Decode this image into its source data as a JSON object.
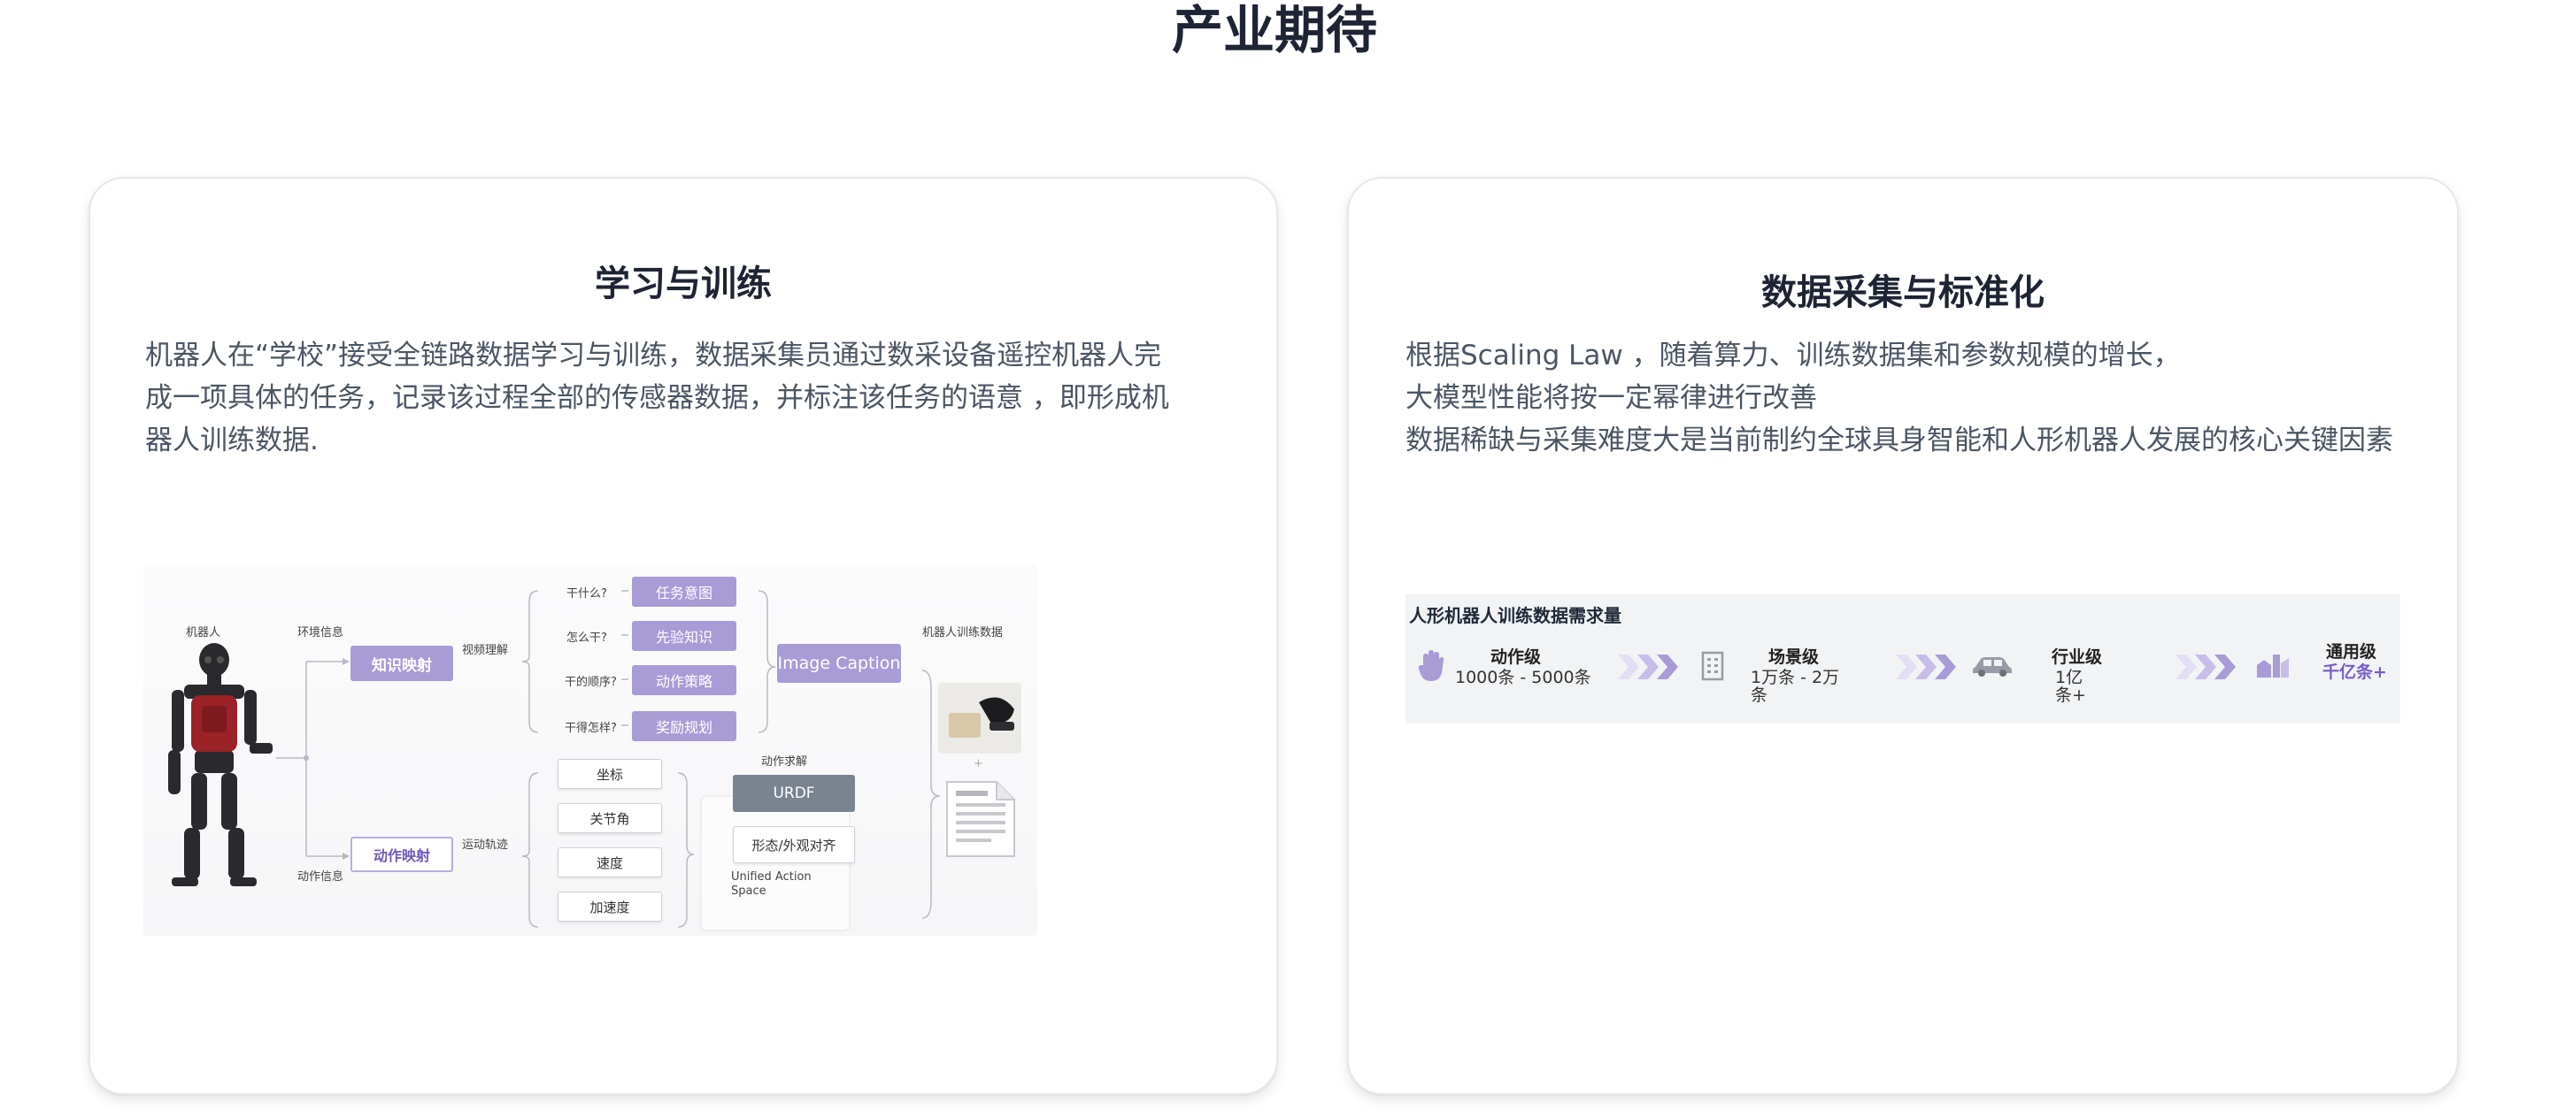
{
  "page": {
    "title": "产业期待"
  },
  "left_card": {
    "title": "学习与训练",
    "paragraph_lines": [
      "机器人在“学校”接受全链路数据学习与训练，数据采集员通过数采设备遥控机器人完",
      "成一项具体的任务，记录该过程全部的传感器数据，并标注该任务的语意 ，即形成机",
      "器人训练数据."
    ],
    "diagram": {
      "robot_label": "机器人",
      "env_info": "环境信息",
      "action_info": "动作信息",
      "knowledge_mapping": "知识映射",
      "action_mapping": "动作映射",
      "video_understanding": "视频理解",
      "motion_trajectory": "运动轨迹",
      "questions": [
        "干什么?",
        "怎么干?",
        "干的顺序?",
        "干得怎样?"
      ],
      "purple_boxes": [
        "任务意图",
        "先验知识",
        "动作策略",
        "奖励规划"
      ],
      "white_boxes": [
        "坐标",
        "关节角",
        "速度",
        "加速度"
      ],
      "image_caption": "Image Caption",
      "training_data_label": "机器人训练数据",
      "action_solve": "动作求解",
      "urdf": "URDF",
      "shape_align": "形态/外观对齐",
      "unified_action_space": "Unified Action Space",
      "plus": "+"
    }
  },
  "right_card": {
    "title": "数据采集与标准化",
    "paragraph_lines": [
      "根据Scaling Law ，随着算力、训练数据集和参数规模的增长，",
      "大模型性能将按一定幂律进行改善",
      "数据稀缺与采集难度大是当前制约全球具身智能和人形机器人发展的核心关键因素"
    ],
    "data_panel": {
      "title": "人形机器人训练数据需求量",
      "levels": [
        {
          "icon": "hand-icon",
          "label": "动作级",
          "value": "1000条 - 5000条"
        },
        {
          "icon": "building-icon",
          "label": "场景级",
          "value": "1万条 - 2万条"
        },
        {
          "icon": "car-icon",
          "label": "行业级",
          "value": "1亿条+"
        },
        {
          "icon": "city-icon",
          "label": "通用级",
          "value": "千亿条+"
        }
      ],
      "colors": {
        "accent": "#7a5cc9",
        "icon": "#a99bd6",
        "panel_bg": "#f1f3f5"
      }
    }
  }
}
